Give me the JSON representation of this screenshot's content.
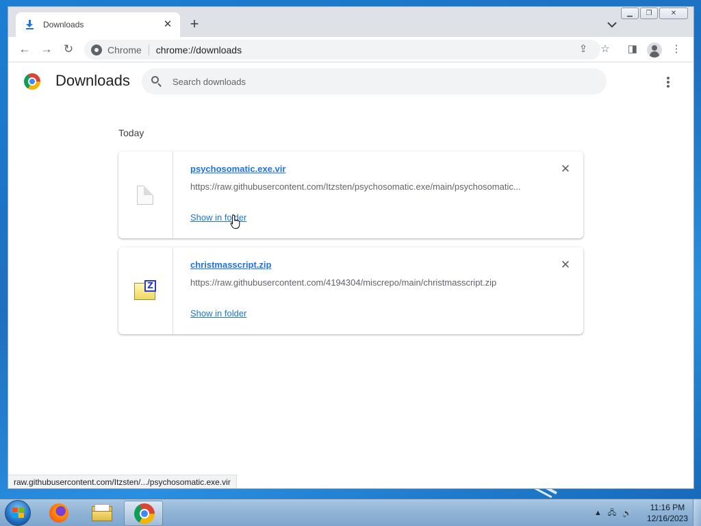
{
  "browser": {
    "tab": {
      "title": "Downloads"
    },
    "omnibox": {
      "chip": "Chrome",
      "url": "chrome://downloads"
    },
    "status_url": "raw.githubusercontent.com/Itzsten/.../psychosomatic.exe.vir"
  },
  "page": {
    "title": "Downloads",
    "search": {
      "placeholder": "Search downloads",
      "value": ""
    },
    "section_date": "Today",
    "downloads": [
      {
        "file_name": "psychosomatic.exe.vir",
        "url": "https://raw.githubusercontent.com/Itzsten/psychosomatic.exe/main/psychosomatic...",
        "action": "Show in folder",
        "icon": "generic-file-icon"
      },
      {
        "file_name": "christmasscript.zip",
        "url": "https://raw.githubusercontent.com/4194304/miscrepo/main/christmasscript.zip",
        "action": "Show in folder",
        "icon": "zip-archive-icon"
      }
    ]
  },
  "taskbar": {
    "apps": [
      "Firefox",
      "Windows Explorer",
      "Google Chrome"
    ],
    "active_app": "Google Chrome",
    "clock": {
      "time": "11:16 PM",
      "date": "12/16/2023"
    }
  },
  "colors": {
    "link": "#1a73e8",
    "desktop": "#1e6fc0",
    "taskbar": "#8fb3d6"
  }
}
